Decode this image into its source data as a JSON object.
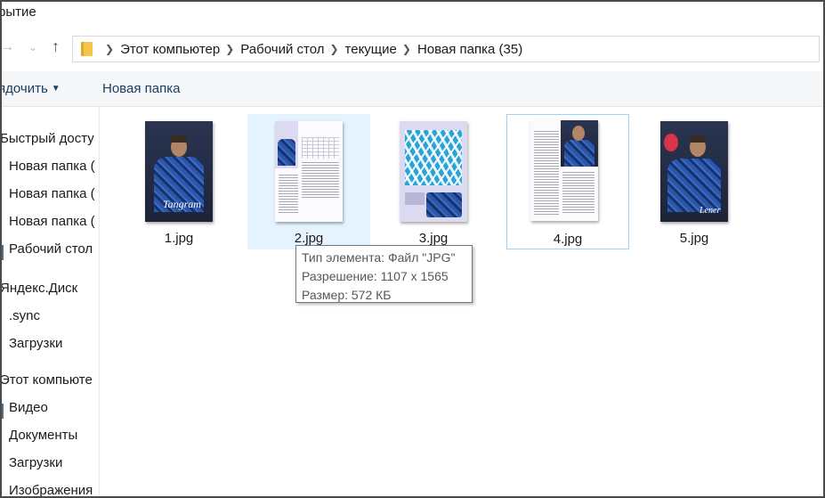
{
  "window": {
    "title": "рытие"
  },
  "nav": {
    "forward_icon": "arrow-right-icon",
    "recent_icon": "chevron-down-icon",
    "up_icon": "arrow-up-icon"
  },
  "address": {
    "crumbs": [
      "Этот компьютер",
      "Рабочий стол",
      "текущие",
      "Новая папка (35)"
    ]
  },
  "toolbar": {
    "sort_label": "ядочить",
    "new_folder_label": "Новая папка"
  },
  "sidebar": {
    "items": [
      {
        "label": "Быстрый досту"
      },
      {
        "label": "Новая папка ("
      },
      {
        "label": "Новая папка ("
      },
      {
        "label": "Новая папка ("
      },
      {
        "label": "Рабочий стол"
      },
      {
        "label": "Яндекс.Диск"
      },
      {
        "label": ".sync"
      },
      {
        "label": "Загрузки"
      },
      {
        "label": "Этот компьюте"
      },
      {
        "label": "Видео"
      },
      {
        "label": "Документы"
      },
      {
        "label": "Загрузки"
      },
      {
        "label": "Изображения"
      }
    ]
  },
  "files": [
    {
      "name": "1.jpg",
      "cover_text": "Tangram"
    },
    {
      "name": "2.jpg"
    },
    {
      "name": "3.jpg"
    },
    {
      "name": "4.jpg"
    },
    {
      "name": "5.jpg",
      "cover_text": "Lener"
    }
  ],
  "tooltip": {
    "type_line": "Тип элемента: Файл \"JPG\"",
    "resolution_line": "Разрешение: 1107 x 1565",
    "size_line": "Размер: 572 КБ"
  },
  "colors": {
    "hover_bg": "#e5f3ff",
    "selection_border": "#99d1ff",
    "toolbar_text": "#1a3e61"
  }
}
